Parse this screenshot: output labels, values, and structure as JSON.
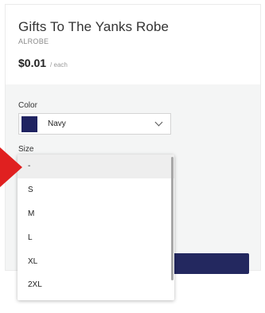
{
  "product": {
    "title": "Gifts To The Yanks Robe",
    "sku": "ALROBE",
    "price": "$0.01",
    "unit": "/ each"
  },
  "color": {
    "label": "Color",
    "value": "Navy",
    "swatch": "#1f2361"
  },
  "size": {
    "label": "Size",
    "options": [
      "-",
      "S",
      "M",
      "L",
      "XL",
      "2XL"
    ],
    "selected": "-"
  },
  "colors": {
    "button": "#23285f",
    "arrow": "#e02020",
    "panel_bg": "#f4f5f5"
  }
}
